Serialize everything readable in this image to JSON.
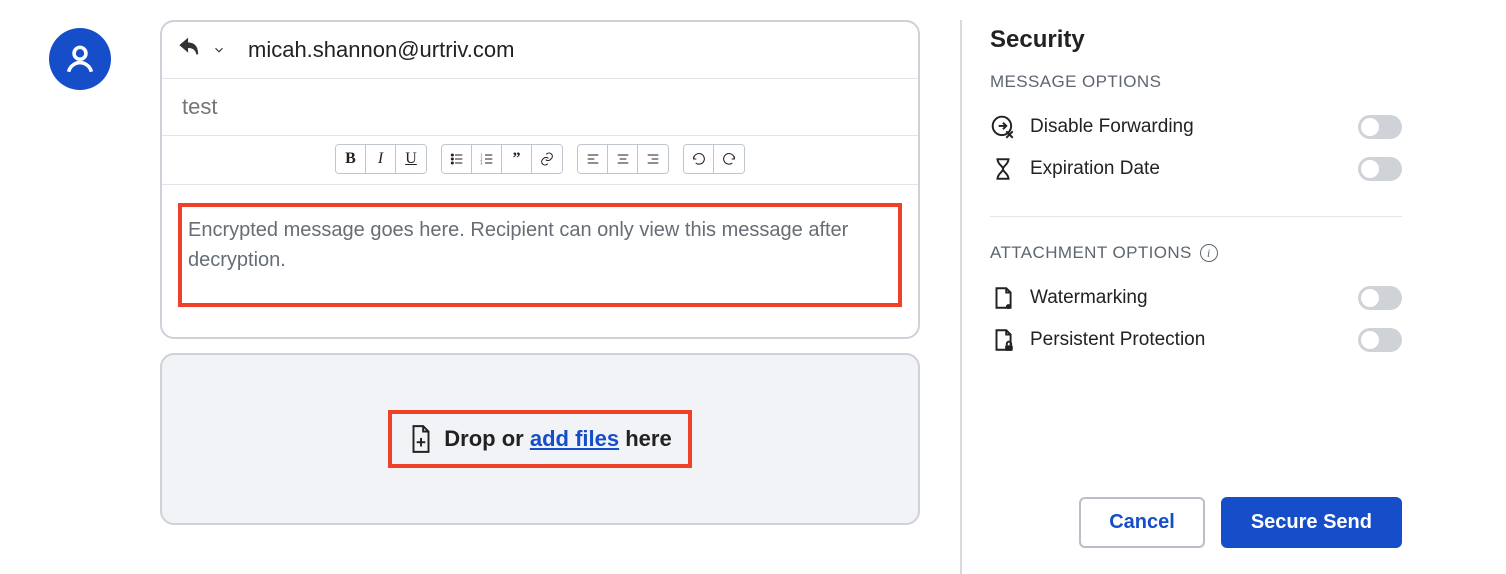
{
  "recipient": {
    "email": "micah.shannon@urtriv.com"
  },
  "subject": {
    "placeholder": "test"
  },
  "editor": {
    "placeholder": "Encrypted message goes here. Recipient can only view this message after decryption."
  },
  "dropzone": {
    "prefix": "Drop or ",
    "link": "add files",
    "suffix": " here"
  },
  "sidebar": {
    "title": "Security",
    "message_section": "MESSAGE OPTIONS",
    "attachment_section": "ATTACHMENT OPTIONS",
    "options": {
      "disable_forwarding": "Disable Forwarding",
      "expiration": "Expiration Date",
      "watermarking": "Watermarking",
      "persistent": "Persistent Protection"
    }
  },
  "actions": {
    "cancel": "Cancel",
    "send": "Secure Send"
  }
}
